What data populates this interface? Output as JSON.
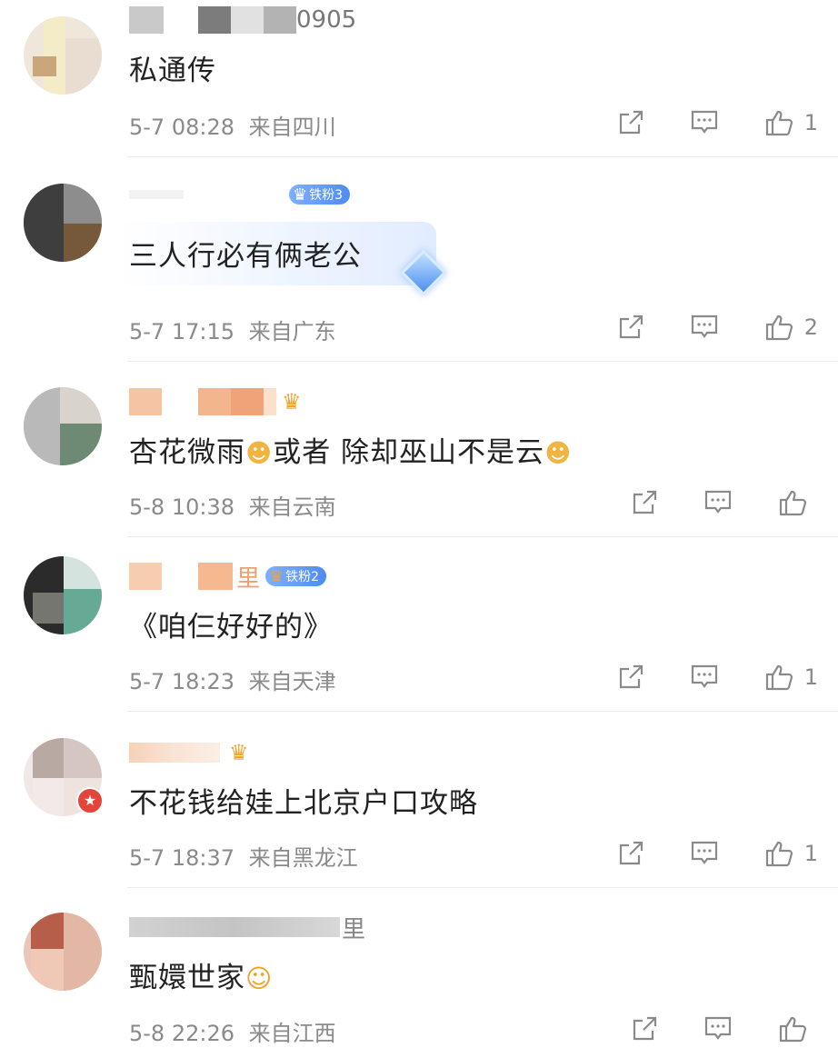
{
  "comments": [
    {
      "username_visible": "0905",
      "text": "私通传",
      "time": "5-7 08:28",
      "location": "来自四川",
      "likes": "1",
      "badge": ""
    },
    {
      "username_visible": "",
      "text": "三人行必有俩老公",
      "time": "5-7 17:15",
      "location": "来自广东",
      "likes": "2",
      "badge": "铁粉3"
    },
    {
      "username_visible": "",
      "text_a": "杏花微雨",
      "text_b": "或者 除却巫山不是云",
      "time": "5-8 10:38",
      "location": "来自云南",
      "likes": "",
      "badge": ""
    },
    {
      "username_visible": "里",
      "text": "《咱仨好好的》",
      "time": "5-7 18:23",
      "location": "来自天津",
      "likes": "1",
      "badge": "铁粉2"
    },
    {
      "username_visible": "",
      "text": "不花钱给娃上北京户口攻略",
      "time": "5-7 18:37",
      "location": "来自黑龙江",
      "likes": "1",
      "badge": ""
    },
    {
      "username_visible": "里",
      "text": "甄嬛世家",
      "time": "5-8 22:26",
      "location": "来自江西",
      "likes": "",
      "badge": ""
    }
  ],
  "icons": {
    "share": "share-icon",
    "reply": "comment-icon",
    "like": "thumbs-up-icon",
    "emoji_face": "doge-emoji",
    "emoji_laugh": "laugh-emoji",
    "crown": "crown-icon",
    "verified": "verified-badge-icon"
  },
  "colors": {
    "text": "#222222",
    "meta": "#8a8a8a",
    "badge_blue": "#4e8cf2",
    "crown_gold": "#f3a32b",
    "verified_red": "#e5443a"
  }
}
